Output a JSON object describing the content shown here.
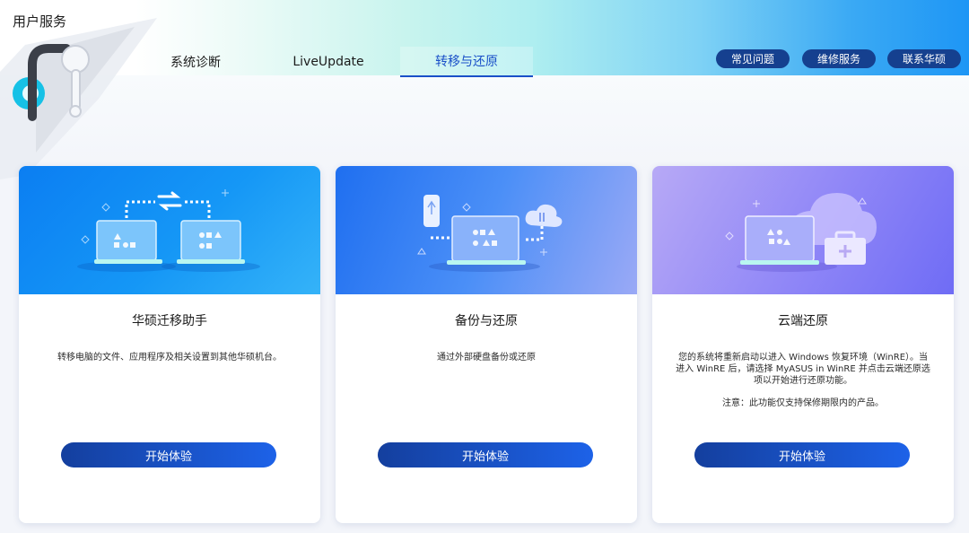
{
  "app": {
    "title": "用户服务"
  },
  "tabs": [
    {
      "label": "系统诊断"
    },
    {
      "label": "LiveUpdate"
    },
    {
      "label": "转移与还原",
      "active": true
    }
  ],
  "header_buttons": {
    "faq": "常见问题",
    "repair": "维修服务",
    "contact": "联系华硕"
  },
  "cards": [
    {
      "title": "华硕迁移助手",
      "description": "转移电脑的文件、应用程序及相关设置到其他华硕机台。",
      "button": "开始体验",
      "illustration": "laptop-transfer-icon"
    },
    {
      "title": "备份与还原",
      "description": "通过外部硬盘备份或还原",
      "button": "开始体验",
      "illustration": "backup-restore-icon"
    },
    {
      "title": "云端还原",
      "description": "您的系统将重新启动以进入 Windows 恢复环境（WinRE）。当进入 WinRE 后，请选择 MyASUS in WinRE 并点击云端还原选项以开始进行还原功能。",
      "note": "注意：此功能仅支持保修期限内的产品。",
      "button": "开始体验",
      "illustration": "cloud-recovery-icon"
    }
  ],
  "colors": {
    "accent": "#1a50c8",
    "button_dark": "#15408f",
    "button_gradient_start": "#143f9e",
    "button_gradient_end": "#1d62e8"
  }
}
